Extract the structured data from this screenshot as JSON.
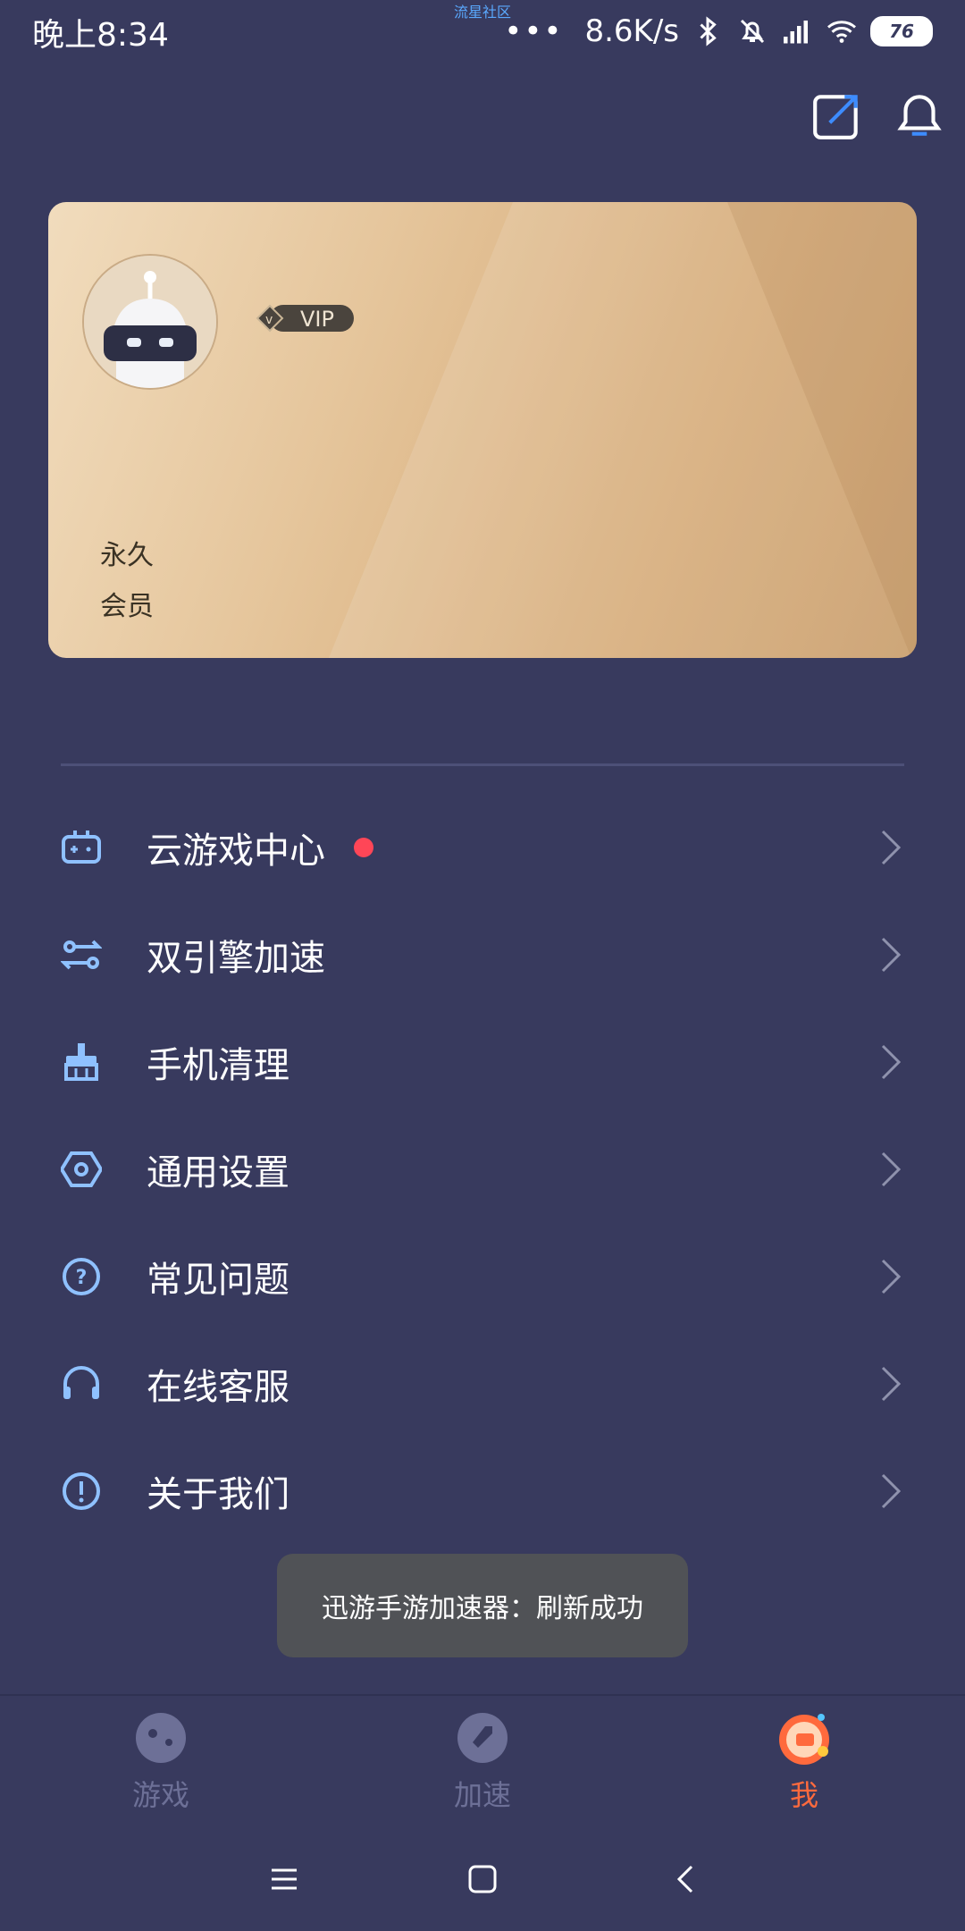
{
  "status_bar": {
    "time": "晚上8:34",
    "carrier_note": "流星社区",
    "dots": "•••",
    "speed": "8.6K/s",
    "battery": "76"
  },
  "card": {
    "vip_label": "VIP",
    "membership_line1": "永久",
    "membership_line2": "会员"
  },
  "menu": {
    "items": [
      {
        "label": "云游戏中心",
        "icon": "gamepad-icon"
      },
      {
        "label": "双引擎加速",
        "icon": "dual-engine-icon"
      },
      {
        "label": "手机清理",
        "icon": "broom-icon"
      },
      {
        "label": "通用设置",
        "icon": "settings-hex-icon"
      },
      {
        "label": "常见问题",
        "icon": "question-icon"
      },
      {
        "label": "在线客服",
        "icon": "headset-icon"
      },
      {
        "label": "关于我们",
        "icon": "info-icon"
      }
    ]
  },
  "toast": {
    "text": "迅游手游加速器：刷新成功"
  },
  "bottom_nav": {
    "tabs": [
      {
        "label": "游戏",
        "active": false
      },
      {
        "label": "加速",
        "active": false
      },
      {
        "label": "我",
        "active": true
      }
    ]
  },
  "colors": {
    "background": "#383a5e",
    "accent": "#ff6a3d",
    "icon_blue": "#8fc1ff",
    "red_dot": "#ff4657"
  }
}
